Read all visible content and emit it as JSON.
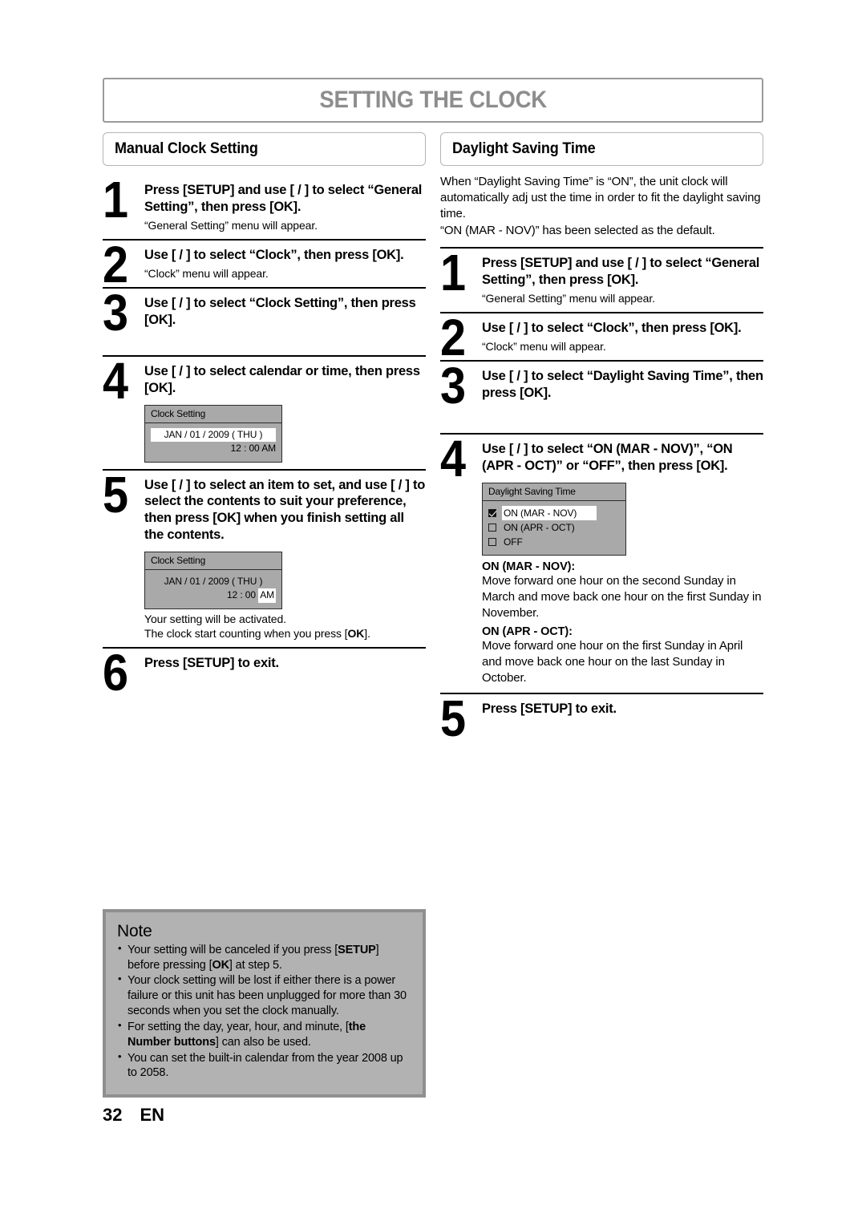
{
  "header": {
    "title": "SETTING THE CLOCK"
  },
  "footer": {
    "page_number": "32",
    "language": "EN"
  },
  "left": {
    "section_title": "Manual Clock Setting",
    "steps": [
      {
        "num": "1",
        "title": "Press [SETUP] and use [    /    ] to select “General Setting”, then press [OK].",
        "sub": "“General Setting” menu will appear."
      },
      {
        "num": "2",
        "title": "Use [    /    ] to select “Clock”, then press [OK].",
        "sub": "“Clock” menu will appear."
      },
      {
        "num": "3",
        "title": "Use [    /    ] to select “Clock Setting”, then press [OK]."
      },
      {
        "num": "4",
        "title": "Use [    /    ] to select calendar or time, then press [OK]."
      },
      {
        "num": "5",
        "title": "Use [    /    ] to select an item to set, and use [    /    ] to select the contents to suit your preference, then press [OK] when you finish setting all the contents.",
        "sub_line1": "Your setting will be activated.",
        "sub_line2_a": "The clock start counting when you press [",
        "sub_line2_b": "OK",
        "sub_line2_c": "]."
      },
      {
        "num": "6",
        "title": "Press [SETUP] to exit."
      }
    ],
    "osd_step4": {
      "title": "Clock Setting",
      "date": "JAN / 01 / 2009 ( THU )",
      "time": "12 : 00 AM"
    },
    "osd_step5": {
      "title": "Clock Setting",
      "date": "JAN / 01 / 2009 ( THU )",
      "time_prefix": "12 : 00 ",
      "time_meridiem": "AM"
    }
  },
  "right": {
    "section_title": "Daylight Saving Time",
    "intro_line1": "When “Daylight Saving Time” is “ON”, the unit clock will automatically adj ust the time in order to fit the daylight saving time.",
    "intro_line2": "“ON (MAR - NOV)” has been selected as the default.",
    "steps": [
      {
        "num": "1",
        "title": "Press [SETUP] and use [    /    ] to select “General Setting”, then press [OK].",
        "sub": "“General Setting” menu will appear."
      },
      {
        "num": "2",
        "title": "Use [    /    ] to select “Clock”, then press [OK].",
        "sub": "“Clock” menu will appear."
      },
      {
        "num": "3",
        "title": "Use [    /    ] to select “Daylight Saving Time”, then press [OK]."
      },
      {
        "num": "4",
        "title": "Use [    /    ] to select “ON (MAR - NOV)”, “ON (APR - OCT)” or “OFF”, then press [OK]."
      },
      {
        "num": "5",
        "title": "Press [SETUP] to exit."
      }
    ],
    "osd_dst": {
      "title": "Daylight Saving Time",
      "options": [
        {
          "label": "ON (MAR - NOV)",
          "checked": true,
          "selected": true
        },
        {
          "label": "ON (APR - OCT)",
          "checked": false,
          "selected": false
        },
        {
          "label": "OFF",
          "checked": false,
          "selected": false
        }
      ]
    },
    "descriptions": [
      {
        "head": "ON (MAR - NOV):",
        "text": "Move forward one hour on the second Sunday in March and move back one hour on the first Sunday in November."
      },
      {
        "head": "ON (APR - OCT):",
        "text": "Move forward one hour on the first Sunday in April and move back one hour on the last Sunday in October."
      }
    ]
  },
  "note": {
    "title": "Note",
    "items": [
      {
        "a": "Your setting will be canceled if you press [",
        "b": "SETUP",
        "c": "] before pressing [",
        "d": "OK",
        "e": "] at step 5."
      },
      {
        "a": "Your clock setting will be lost if either there is a power failure or this unit has been unplugged for more than 30 seconds when you set the clock manually.",
        "b": "",
        "c": "",
        "d": "",
        "e": ""
      },
      {
        "a": "For setting the day, year, hour, and minute, [",
        "b": "the Number buttons",
        "c": "] can also be used.",
        "d": "",
        "e": ""
      },
      {
        "a": "You can set the built-in calendar from the year 2008 up to 2058.",
        "b": "",
        "c": "",
        "d": "",
        "e": ""
      }
    ]
  }
}
